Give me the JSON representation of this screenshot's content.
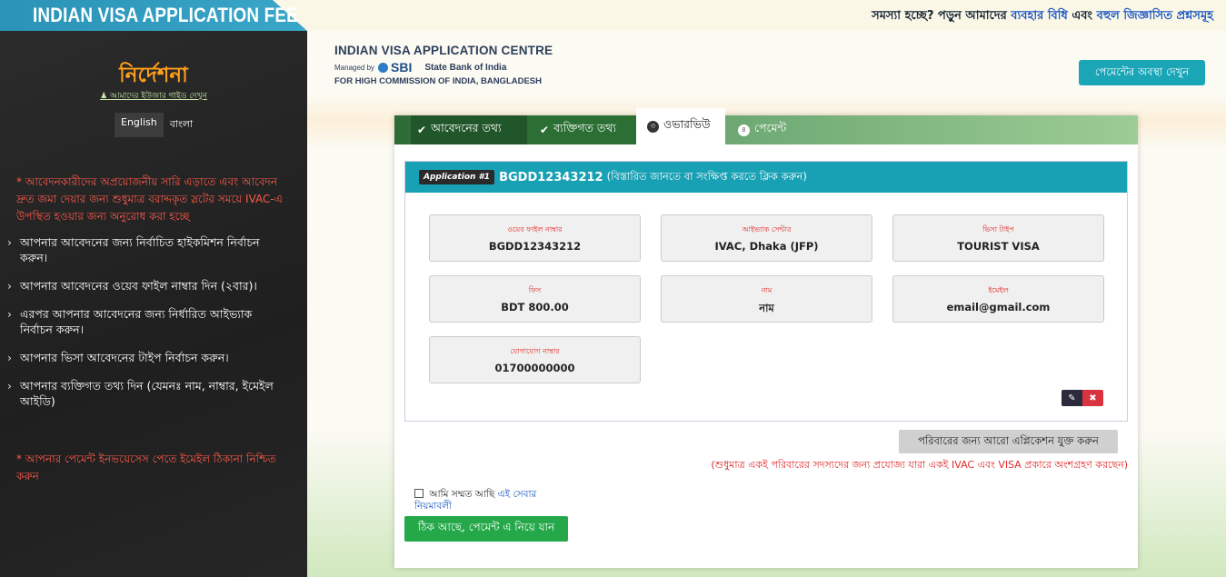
{
  "header": {
    "brand_title": "INDIAN VISA APPLICATION FEE",
    "help_prefix": "সমস্যা হচ্ছে? পড়ুন আমাদের",
    "help_link1": "ব্যবহার বিধি",
    "help_and": "এবং",
    "help_link2": "বহুল জিজ্ঞাসিত প্রশ্নসমূহ"
  },
  "sidebar": {
    "title": "নির্দেশনা",
    "guide_link": "আমাদের ইউজার গাইড দেখুন",
    "lang_english": "English",
    "lang_bangla": "বাংলা",
    "note_top": "* আবেদনকারীদের অপ্রয়োজনীয় সারি এড়াতে এবং আবেদন দ্রুত জমা দেয়ার জন্য শুধুমাত্র বরাদ্দকৃত স্লটের সময়ে IVAC-এ উপস্থিত হওয়ার জন্য অনুরোধ করা হচ্ছে",
    "steps": [
      "আপনার আবেদনের জন্য নির্বাচিত হাইকমিশন নির্বাচন করুন।",
      "আপনার আবেদনের ওয়েব ফাইল নাম্বার দিন (২বার)।",
      "এরপর আপনার আবেদনের জন্য নির্ধারিত আইভ্যাক নির্বাচন করুন।",
      "আপনার ভিসা আবেদনের টাইপ নির্বাচন করুন।",
      "আপনার ব্যক্তিগত তথ্য দিন (যেমনঃ নাম, নাম্বার, ইমেইল আইডি)"
    ],
    "note_bottom": "* আপনার পেমেন্ট ইনভয়েসেস পেতে ইমেইল ঠিকানা নিশ্চিত করুন"
  },
  "logo": {
    "line1": "INDIAN VISA APPLICATION CENTRE",
    "managed_by": "Managed by",
    "sbi": "SBI",
    "sbi_name": "State Bank of India",
    "line3": "FOR HIGH COMMISSION OF INDIA, BANGLADESH"
  },
  "status_button": "পেমেন্টের অবস্থা দেখুন",
  "tabs": {
    "t1": "আবেদনের তথ্য",
    "t2": "ব্যক্তিগত তথ্য",
    "t3_num": "৩",
    "t3": "ওভারভিউ",
    "t4_num": "৪",
    "t4": "পেমেন্ট"
  },
  "application": {
    "badge": "Application #1",
    "id": "BGDD12343212",
    "hint": "(বিস্তারিত জানতে বা সংক্ষিপ্ত করতে ক্লিক করুন)",
    "fields": {
      "web_file": {
        "label": "ওয়েব ফাইল নাম্বার",
        "value": "BGDD12343212"
      },
      "ivac_center": {
        "label": "আইভ্যাক সেন্টার",
        "value": "IVAC, Dhaka (JFP)"
      },
      "visa_type": {
        "label": "ভিসা টাইপ",
        "value": "TOURIST VISA"
      },
      "fee": {
        "label": "ফিস",
        "value": "BDT 800.00"
      },
      "name": {
        "label": "নাম",
        "value": "নাম"
      },
      "email": {
        "label": "ইমেইল",
        "value": "email@gmail.com"
      },
      "phone": {
        "label": "যোগাযোগ নাম্বার",
        "value": "01700000000"
      }
    }
  },
  "family_button": "পরিবারের জন্য আরো এপ্লিকেশন যুক্ত করুন",
  "family_note": "(শুধুমাত্র একই পরিবারের সদস্যদের জন্য প্রযোজ্য যারা একই IVAC এবং VISA প্রকারে অংশগ্রহণ করছেন)",
  "agree": {
    "text": "আমি সম্মত আছি",
    "link": "এই সেবার নিয়মাবলী"
  },
  "proceed_button": "ঠিক আছে, পেমেন্ট এ নিয়ে যান",
  "colors": {
    "accent_teal": "#18a0b4",
    "proceed_green": "#24a84a",
    "warning_red": "#e02a2a",
    "sidebar_title_orange": "#ff9f1a"
  }
}
